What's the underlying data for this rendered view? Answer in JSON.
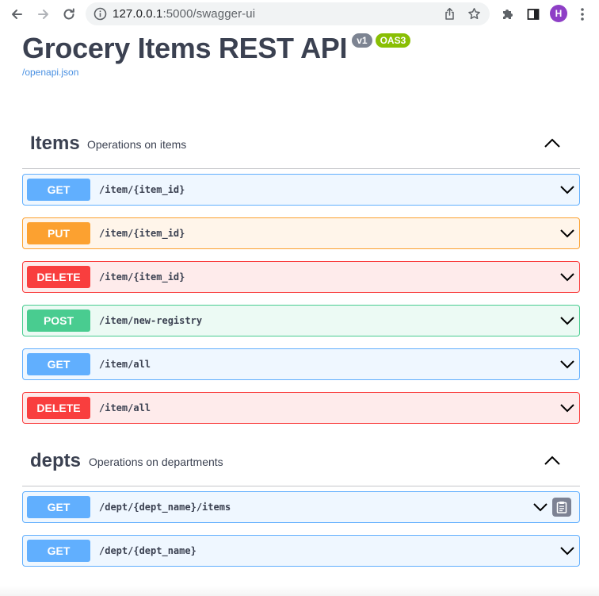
{
  "browser": {
    "url_host": "127.0.0.1",
    "url_path": ":5000/swagger-ui",
    "avatar_letter": "H"
  },
  "info": {
    "title": "Grocery Items REST API",
    "version": "v1",
    "oas": "OAS3",
    "spec_link": "/openapi.json"
  },
  "tags": [
    {
      "name": "Items",
      "description": "Operations on items",
      "operations": [
        {
          "method": "GET",
          "path": "/item/{item_id}"
        },
        {
          "method": "PUT",
          "path": "/item/{item_id}"
        },
        {
          "method": "DELETE",
          "path": "/item/{item_id}"
        },
        {
          "method": "POST",
          "path": "/item/new-registry"
        },
        {
          "method": "GET",
          "path": "/item/all"
        },
        {
          "method": "DELETE",
          "path": "/item/all"
        }
      ]
    },
    {
      "name": "depts",
      "description": "Operations on departments",
      "operations": [
        {
          "method": "GET",
          "path": "/dept/{dept_name}/items"
        },
        {
          "method": "GET",
          "path": "/dept/{dept_name}"
        }
      ]
    }
  ],
  "colors": {
    "get": "#61affe",
    "put": "#fca130",
    "delete": "#f93e3e",
    "post": "#49cc90",
    "version_badge": "#7d8492",
    "oas_badge": "#89bf04"
  },
  "icons": {
    "back": "back-arrow-icon",
    "forward": "forward-arrow-icon",
    "reload": "reload-icon",
    "site_info": "site-info-icon",
    "share": "share-icon",
    "bookmark": "star-icon",
    "extensions": "puzzle-icon",
    "side_panel": "side-panel-icon",
    "menu": "more-vert-icon",
    "collapse": "chevron-up-icon",
    "expand": "chevron-down-icon",
    "copy": "clipboard-icon"
  }
}
